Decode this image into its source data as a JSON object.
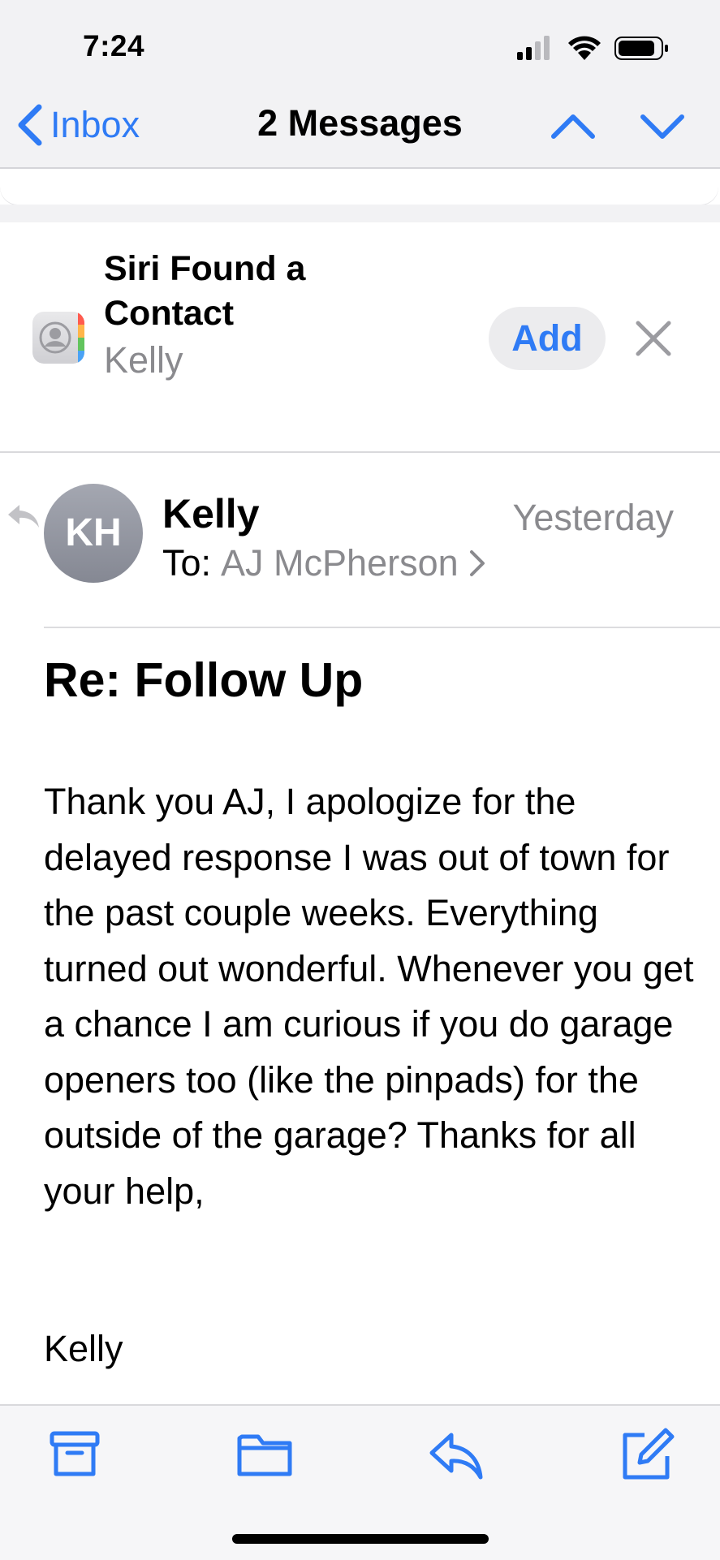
{
  "status_bar": {
    "time": "7:24"
  },
  "nav": {
    "back_label": "Inbox",
    "title": "2 Messages"
  },
  "siri_suggestion": {
    "title": "Siri Found a Contact",
    "contact_name": "Kelly",
    "add_label": "Add"
  },
  "message": {
    "avatar_initials": "KH",
    "sender": "Kelly",
    "date": "Yesterday",
    "to_label": "To:",
    "to_recipient": "AJ McPherson",
    "subject": "Re: Follow Up",
    "body": "Thank you AJ, I apologize for the delayed response I was out of town for the past couple weeks. Everything turned out wonderful. Whenever you get a chance I am curious if you do garage openers too (like the pinpads) for the outside of the garage? Thanks for all your help,",
    "signature": "Kelly"
  },
  "toolbar": {
    "icons": [
      "archive-icon",
      "folder-icon",
      "reply-icon",
      "compose-icon"
    ]
  },
  "colors": {
    "accent": "#2f7bf5",
    "secondary_text": "#8a8a8e",
    "background_gray": "#f2f2f4"
  }
}
